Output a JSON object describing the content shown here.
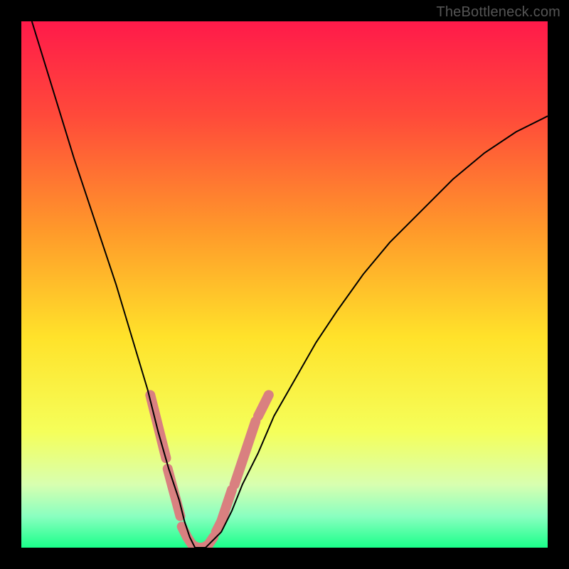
{
  "watermark": "TheBottleneck.com",
  "chart_data": {
    "type": "line",
    "title": "",
    "xlabel": "",
    "ylabel": "",
    "xlim": [
      0,
      100
    ],
    "ylim": [
      0,
      100
    ],
    "background_gradient": {
      "stops": [
        {
          "pct": 0,
          "color": "#ff1a4a"
        },
        {
          "pct": 18,
          "color": "#ff4a3a"
        },
        {
          "pct": 40,
          "color": "#ff9a2a"
        },
        {
          "pct": 60,
          "color": "#ffe22a"
        },
        {
          "pct": 78,
          "color": "#f5ff5a"
        },
        {
          "pct": 88,
          "color": "#d8ffb0"
        },
        {
          "pct": 94,
          "color": "#8affc0"
        },
        {
          "pct": 100,
          "color": "#1aff8a"
        }
      ]
    },
    "series": [
      {
        "name": "bottleneck-curve",
        "color": "#000000",
        "x": [
          2,
          6,
          10,
          14,
          18,
          21,
          24,
          26,
          28,
          30,
          31,
          32,
          33,
          34,
          35,
          36,
          38,
          40,
          42,
          45,
          48,
          52,
          56,
          60,
          65,
          70,
          76,
          82,
          88,
          94,
          100
        ],
        "y": [
          100,
          87,
          74,
          62,
          50,
          40,
          30,
          22,
          15,
          9,
          5,
          2,
          0,
          0,
          0,
          1,
          3,
          7,
          12,
          18,
          25,
          32,
          39,
          45,
          52,
          58,
          64,
          70,
          75,
          79,
          82
        ]
      },
      {
        "name": "highlight-segments",
        "color": "#d98080",
        "segments": [
          {
            "x": [
              24.5,
              25.5,
              26.5,
              27.5
            ],
            "y": [
              29,
              25,
              21,
              17
            ]
          },
          {
            "x": [
              27.8,
              28.6,
              29.4,
              30.2
            ],
            "y": [
              15,
              12,
              9,
              6
            ]
          },
          {
            "x": [
              30.5,
              31.5,
              32.5,
              33.5,
              34.5,
              35.5,
              36.5
            ],
            "y": [
              4,
              2,
              0.5,
              0,
              0,
              0.5,
              2
            ]
          },
          {
            "x": [
              37.0,
              38.0,
              39.0,
              40.0
            ],
            "y": [
              3,
              5,
              8,
              11
            ]
          },
          {
            "x": [
              40.5,
              41.5,
              42.5,
              43.5,
              44.5
            ],
            "y": [
              12,
              15,
              18,
              21,
              24
            ]
          },
          {
            "x": [
              45.0,
              46.0,
              47.0
            ],
            "y": [
              25,
              27,
              29
            ]
          }
        ]
      }
    ]
  }
}
